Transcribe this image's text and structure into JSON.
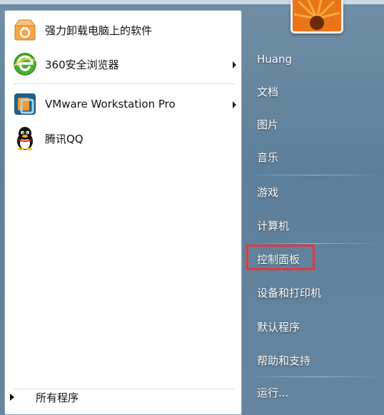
{
  "programs": [
    {
      "label": "强力卸载电脑上的软件",
      "icon": "uninstall-box-icon",
      "has_submenu": false
    },
    {
      "label": "360安全浏览器",
      "icon": "360-browser-icon",
      "has_submenu": true
    },
    {
      "label": "VMware Workstation Pro",
      "icon": "vmware-icon",
      "has_submenu": true
    },
    {
      "label": "腾讯QQ",
      "icon": "qq-penguin-icon",
      "has_submenu": false
    }
  ],
  "all_programs_label": "所有程序",
  "right_menu": [
    {
      "label": "Huang"
    },
    {
      "label": "文档"
    },
    {
      "label": "图片"
    },
    {
      "label": "音乐"
    },
    {
      "label": "游戏"
    },
    {
      "label": "计算机"
    },
    {
      "label": "控制面板",
      "highlighted": true
    },
    {
      "label": "设备和打印机"
    },
    {
      "label": "默认程序"
    },
    {
      "label": "帮助和支持"
    },
    {
      "label": "运行..."
    }
  ],
  "colors": {
    "frame": "#5e7f99",
    "highlight_border": "#e8353f"
  }
}
